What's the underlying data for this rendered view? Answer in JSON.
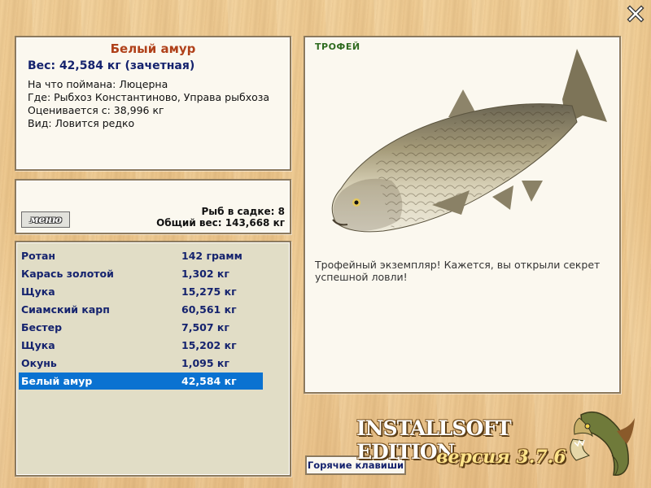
{
  "window": {
    "close_label": "X"
  },
  "fish_info": {
    "title": "Белый амур",
    "weight_line": "Вес: 42,584 кг (зачетная)",
    "lines": [
      "На что поймана: Люцерна",
      "Где: Рыбхоз Константиново, Управа рыбхоза",
      "Оценивается с: 38,996 кг",
      "Вид: Ловится редко"
    ]
  },
  "cage": {
    "menu_label": "меню",
    "count_line": "Рыб в садке: 8",
    "total_line": "Общий вес: 143,668 кг"
  },
  "catch_list": [
    {
      "name": "Ротан",
      "weight": "142 грамм",
      "selected": false
    },
    {
      "name": "Карась золотой",
      "weight": "1,302 кг",
      "selected": false
    },
    {
      "name": "Щука",
      "weight": "15,275 кг",
      "selected": false
    },
    {
      "name": "Сиамский карп",
      "weight": "60,561 кг",
      "selected": false
    },
    {
      "name": "Бестер",
      "weight": "7,507 кг",
      "selected": false
    },
    {
      "name": "Щука",
      "weight": "15,202 кг",
      "selected": false
    },
    {
      "name": "Окунь",
      "weight": "1,095 кг",
      "selected": false
    },
    {
      "name": "Белый амур",
      "weight": "42,584 кг",
      "selected": true
    }
  ],
  "trophy": {
    "tag": "ТРОФЕЙ",
    "description": "Трофейный экземпляр! Кажется, вы открыли секрет успешной ловли!"
  },
  "hotkeys_label": "Горячие клавиши",
  "branding": {
    "edition": "INSTALLSOFT EDITION",
    "version": "версия 3.7.6"
  },
  "colors": {
    "selection": "#0a72d1",
    "list_text": "#15236e",
    "title": "#b0411a",
    "trophy_tag": "#2f6b1f"
  }
}
